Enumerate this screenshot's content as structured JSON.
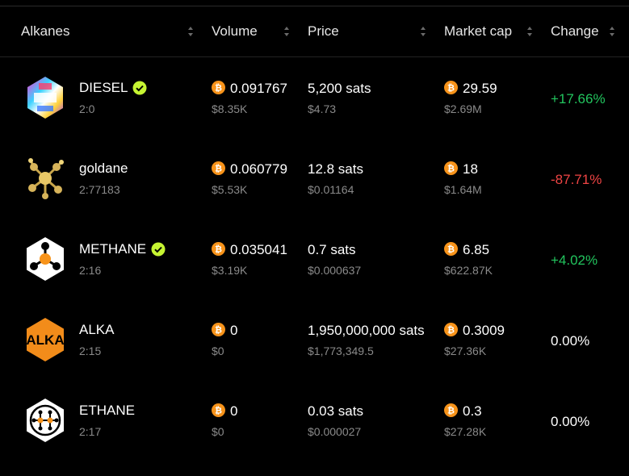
{
  "header": {
    "col_alkanes": "Alkanes",
    "col_volume": "Volume",
    "col_price": "Price",
    "col_market_cap": "Market cap",
    "col_change": "Change"
  },
  "colors": {
    "positive": "#22c55e",
    "negative": "#ef4444",
    "verified": "#c6f432",
    "btc": "#f7931a"
  },
  "rows": [
    {
      "name": "DIESEL",
      "id": "2:0",
      "verified": true,
      "logo": "diesel-logo",
      "volume": "0.091767",
      "volume_usd": "$8.35K",
      "price": "5,200 sats",
      "price_usd": "$4.73",
      "market_cap": "29.59",
      "market_cap_usd": "$2.69M",
      "change": "+17.66%",
      "change_dir": "pos"
    },
    {
      "name": "goldane",
      "id": "2:77183",
      "verified": false,
      "logo": "goldane-logo",
      "volume": "0.060779",
      "volume_usd": "$5.53K",
      "price": "12.8 sats",
      "price_usd": "$0.01164",
      "market_cap": "18",
      "market_cap_usd": "$1.64M",
      "change": "-87.71%",
      "change_dir": "neg"
    },
    {
      "name": "METHANE",
      "id": "2:16",
      "verified": true,
      "logo": "methane-logo",
      "volume": "0.035041",
      "volume_usd": "$3.19K",
      "price": "0.7 sats",
      "price_usd": "$0.000637",
      "market_cap": "6.85",
      "market_cap_usd": "$622.87K",
      "change": "+4.02%",
      "change_dir": "pos"
    },
    {
      "name": "ALKA",
      "id": "2:15",
      "verified": false,
      "logo": "alka-logo",
      "logo_text": "ALKA",
      "volume": "0",
      "volume_usd": "$0",
      "price": "1,950,000,000 sats",
      "price_usd": "$1,773,349.5",
      "market_cap": "0.3009",
      "market_cap_usd": "$27.36K",
      "change": "0.00%",
      "change_dir": "zero"
    },
    {
      "name": "ETHANE",
      "id": "2:17",
      "verified": false,
      "logo": "ethane-logo",
      "volume": "0",
      "volume_usd": "$0",
      "price": "0.03 sats",
      "price_usd": "$0.000027",
      "market_cap": "0.3",
      "market_cap_usd": "$27.28K",
      "change": "0.00%",
      "change_dir": "zero"
    }
  ]
}
